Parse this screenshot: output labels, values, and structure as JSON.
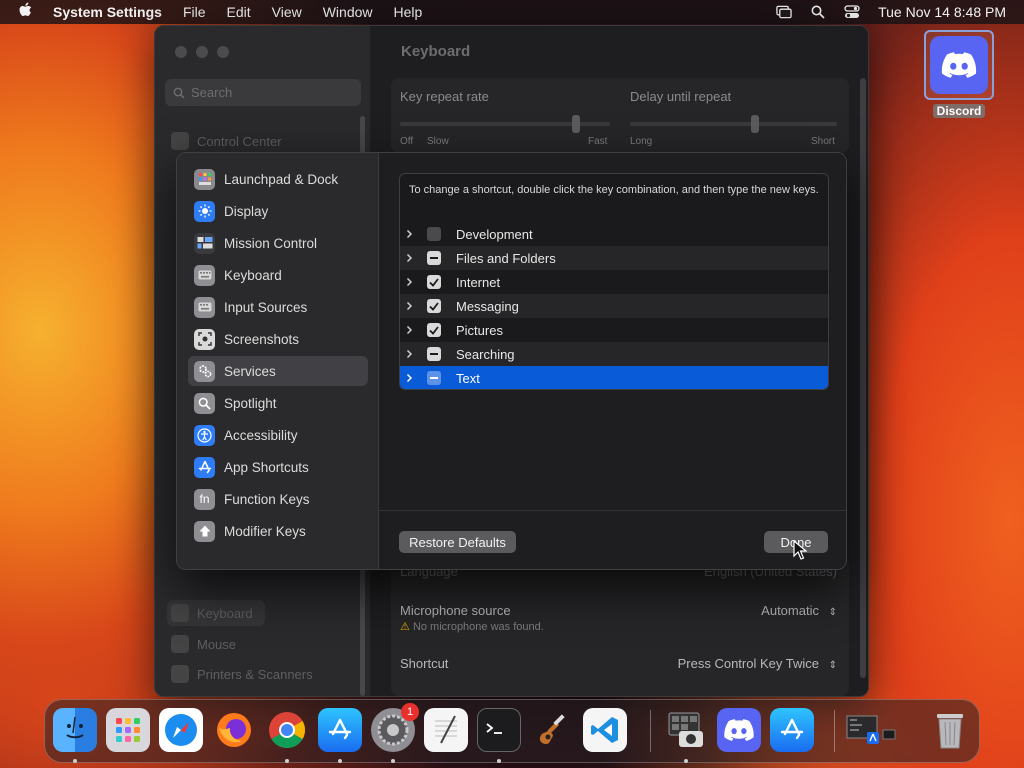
{
  "menubar": {
    "app_name": "System Settings",
    "menus": [
      "File",
      "Edit",
      "View",
      "Window",
      "Help"
    ],
    "datetime": "Tue Nov 14  8:48 PM"
  },
  "desktop": {
    "icon_label": "Discord"
  },
  "background_window": {
    "search_placeholder": "Search",
    "sidebar": {
      "control_center": "Control Center",
      "keyboard": "Keyboard",
      "mouse": "Mouse",
      "printers": "Printers & Scanners"
    },
    "title": "Keyboard",
    "key_repeat_label": "Key repeat rate",
    "delay_label": "Delay until repeat",
    "key_repeat_ticks": [
      "Off",
      "Slow",
      "Fast"
    ],
    "delay_ticks": [
      "Long",
      "Short"
    ],
    "language_label": "Language",
    "language_value": "English (United States)",
    "mic_label": "Microphone source",
    "mic_value": "Automatic",
    "mic_warning": "No microphone was found.",
    "shortcut_label": "Shortcut",
    "shortcut_value": "Press Control Key Twice"
  },
  "modal": {
    "nav": [
      {
        "label": "Launchpad & Dock",
        "icon": "launchpad-icon",
        "color": "#8a8a8e"
      },
      {
        "label": "Display",
        "icon": "display-icon",
        "color": "#2f7df6"
      },
      {
        "label": "Mission Control",
        "icon": "mission-control-icon",
        "color": "#3a3a3c"
      },
      {
        "label": "Keyboard",
        "icon": "keyboard-icon",
        "color": "#8e8e93"
      },
      {
        "label": "Input Sources",
        "icon": "input-sources-icon",
        "color": "#8e8e93"
      },
      {
        "label": "Screenshots",
        "icon": "screenshot-icon",
        "color": "#d9d9d9"
      },
      {
        "label": "Services",
        "icon": "services-icon",
        "color": "#8e8e93"
      },
      {
        "label": "Spotlight",
        "icon": "spotlight-icon",
        "color": "#8e8e93"
      },
      {
        "label": "Accessibility",
        "icon": "accessibility-icon",
        "color": "#2f7df6"
      },
      {
        "label": "App Shortcuts",
        "icon": "app-shortcuts-icon",
        "color": "#2f7df6"
      },
      {
        "label": "Function Keys",
        "icon": "function-keys-icon",
        "color": "#8e8e93"
      },
      {
        "label": "Modifier Keys",
        "icon": "modifier-keys-icon",
        "color": "#8e8e93"
      }
    ],
    "active_nav": "Services",
    "hint": "To change a shortcut, double click the key combination, and then type the new keys.",
    "rows": [
      {
        "label": "Development",
        "state": "unchecked"
      },
      {
        "label": "Files and Folders",
        "state": "mixed"
      },
      {
        "label": "Internet",
        "state": "checked"
      },
      {
        "label": "Messaging",
        "state": "checked"
      },
      {
        "label": "Pictures",
        "state": "checked"
      },
      {
        "label": "Searching",
        "state": "mixed"
      },
      {
        "label": "Text",
        "state": "mixed"
      }
    ],
    "selected_row": "Text",
    "restore_defaults": "Restore Defaults",
    "done": "Done"
  },
  "dock": {
    "apps": [
      "Finder",
      "Launchpad",
      "Safari",
      "Firefox",
      "Chrome",
      "App Store",
      "System Settings",
      "TextEdit",
      "Terminal",
      "GarageBand",
      "Visual Studio Code",
      "Image Capture",
      "Discord",
      "App Store"
    ],
    "settings_badge": "1"
  },
  "colors": {
    "accent": "#0a5bd8",
    "discord": "#5865f2"
  }
}
